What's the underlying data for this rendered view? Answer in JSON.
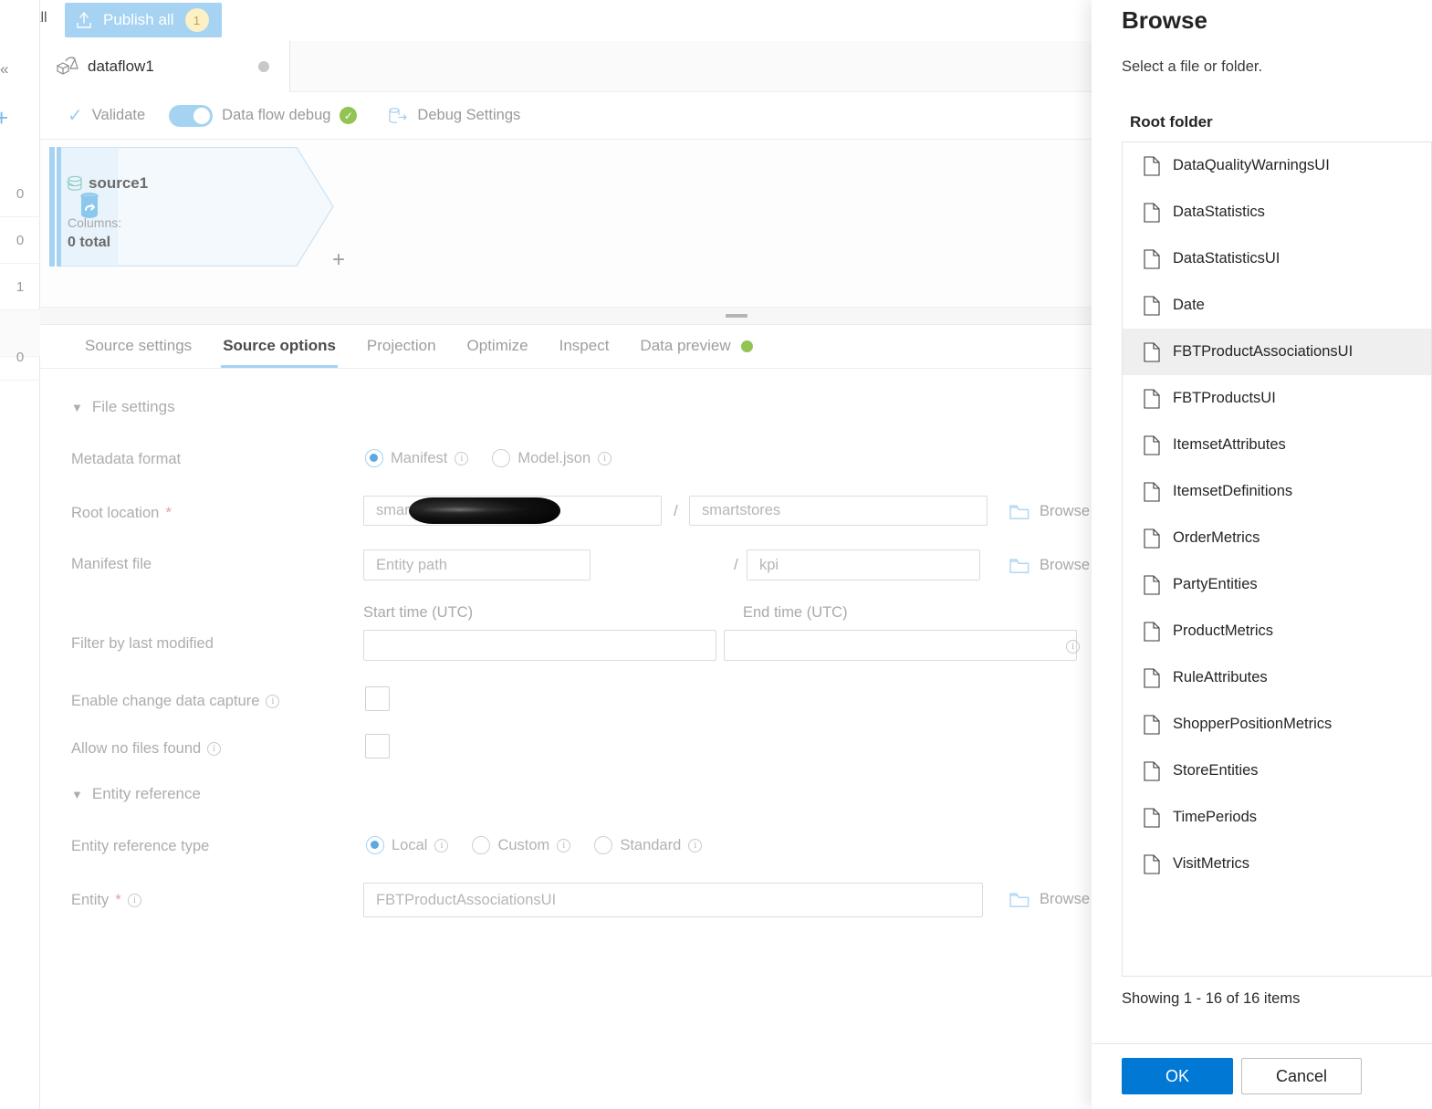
{
  "colors": {
    "accent_blue": "#0078d4",
    "muted_blue": "#a6d3f2",
    "green_status": "#92c353",
    "badge_yellow": "#fbf0c6",
    "selected_row": "#efefef"
  },
  "topbar": {
    "truncated_left_label": "date all",
    "publish_all_label": "Publish all",
    "publish_all_count": "1",
    "upload_icon": "upload-icon"
  },
  "left_rail": {
    "collapse_icon": "chevron-double-left-icon",
    "add_icon": "plus-icon",
    "counts": [
      "0",
      "0",
      "1",
      "0"
    ]
  },
  "dataflow_tab": {
    "name": "dataflow1",
    "icon": "dataflow-icon",
    "unsaved_dot": "unsaved-indicator"
  },
  "command_bar": {
    "validate_label": "Validate",
    "validate_icon": "checkmark-icon",
    "data_flow_debug_label": "Data flow debug",
    "debug_toggle_state": "on",
    "debug_status_icon": "success-check-icon",
    "debug_settings_label": "Debug Settings",
    "debug_settings_icon": "database-export-icon"
  },
  "canvas": {
    "node": {
      "name": "source1",
      "source_icon": "database-source-icon",
      "stream_icon": "source-stream-icon",
      "columns_label": "Columns:",
      "columns_value": "0 total",
      "add_icon": "plus-icon"
    }
  },
  "detail_tabs": [
    {
      "label": "Source settings",
      "active": false
    },
    {
      "label": "Source options",
      "active": true
    },
    {
      "label": "Projection",
      "active": false
    },
    {
      "label": "Optimize",
      "active": false
    },
    {
      "label": "Inspect",
      "active": false
    },
    {
      "label": "Data preview",
      "active": false,
      "status_dot": "green"
    }
  ],
  "form": {
    "file_settings_section": "File settings",
    "entity_reference_section": "Entity reference",
    "metadata_format": {
      "label": "Metadata format",
      "options": [
        {
          "label": "Manifest",
          "selected": true,
          "info_icon": "info-icon"
        },
        {
          "label": "Model.json",
          "selected": false,
          "info_icon": "info-icon"
        }
      ]
    },
    "root_location": {
      "label": "Root location",
      "required": "*",
      "container_value": "smar",
      "container_redacted": true,
      "path_value": "smartstores",
      "separator": "/",
      "browse_label": "Browse",
      "browse_icon": "folder-icon"
    },
    "manifest_file": {
      "label": "Manifest file",
      "entity_path_placeholder": "Entity path",
      "file_value": "kpi",
      "separator": "/",
      "browse_label": "Browse",
      "browse_icon": "folder-icon"
    },
    "filter_by_last_modified": {
      "label": "Filter by last modified",
      "start_time_label": "Start time (UTC)",
      "end_time_label": "End time (UTC)",
      "start_time_value": "",
      "end_time_value": "",
      "info_icon": "info-icon"
    },
    "enable_cdc": {
      "label": "Enable change data capture",
      "checked": false,
      "info_icon": "info-icon"
    },
    "allow_no_files": {
      "label": "Allow no files found",
      "checked": false,
      "info_icon": "info-icon"
    },
    "entity_reference_type": {
      "label": "Entity reference type",
      "options": [
        {
          "label": "Local",
          "selected": true,
          "info_icon": "info-icon"
        },
        {
          "label": "Custom",
          "selected": false,
          "info_icon": "info-icon"
        },
        {
          "label": "Standard",
          "selected": false,
          "info_icon": "info-icon"
        }
      ]
    },
    "entity": {
      "label": "Entity",
      "required": "*",
      "info_icon": "info-icon",
      "value": "FBTProductAssociationsUI",
      "browse_label": "Browse",
      "browse_icon": "folder-icon"
    }
  },
  "browse_panel": {
    "title": "Browse",
    "subtitle": "Select a file or folder.",
    "root_folder_label": "Root folder",
    "file_icon": "file-icon",
    "items": [
      {
        "name": "DataQualityWarningsUI",
        "selected": false
      },
      {
        "name": "DataStatistics",
        "selected": false
      },
      {
        "name": "DataStatisticsUI",
        "selected": false
      },
      {
        "name": "Date",
        "selected": false
      },
      {
        "name": "FBTProductAssociationsUI",
        "selected": true
      },
      {
        "name": "FBTProductsUI",
        "selected": false
      },
      {
        "name": "ItemsetAttributes",
        "selected": false
      },
      {
        "name": "ItemsetDefinitions",
        "selected": false
      },
      {
        "name": "OrderMetrics",
        "selected": false
      },
      {
        "name": "PartyEntities",
        "selected": false
      },
      {
        "name": "ProductMetrics",
        "selected": false
      },
      {
        "name": "RuleAttributes",
        "selected": false
      },
      {
        "name": "ShopperPositionMetrics",
        "selected": false
      },
      {
        "name": "StoreEntities",
        "selected": false
      },
      {
        "name": "TimePeriods",
        "selected": false
      },
      {
        "name": "VisitMetrics",
        "selected": false
      }
    ],
    "showing_text": "Showing 1 - 16 of 16 items",
    "ok_label": "OK",
    "cancel_label": "Cancel"
  }
}
